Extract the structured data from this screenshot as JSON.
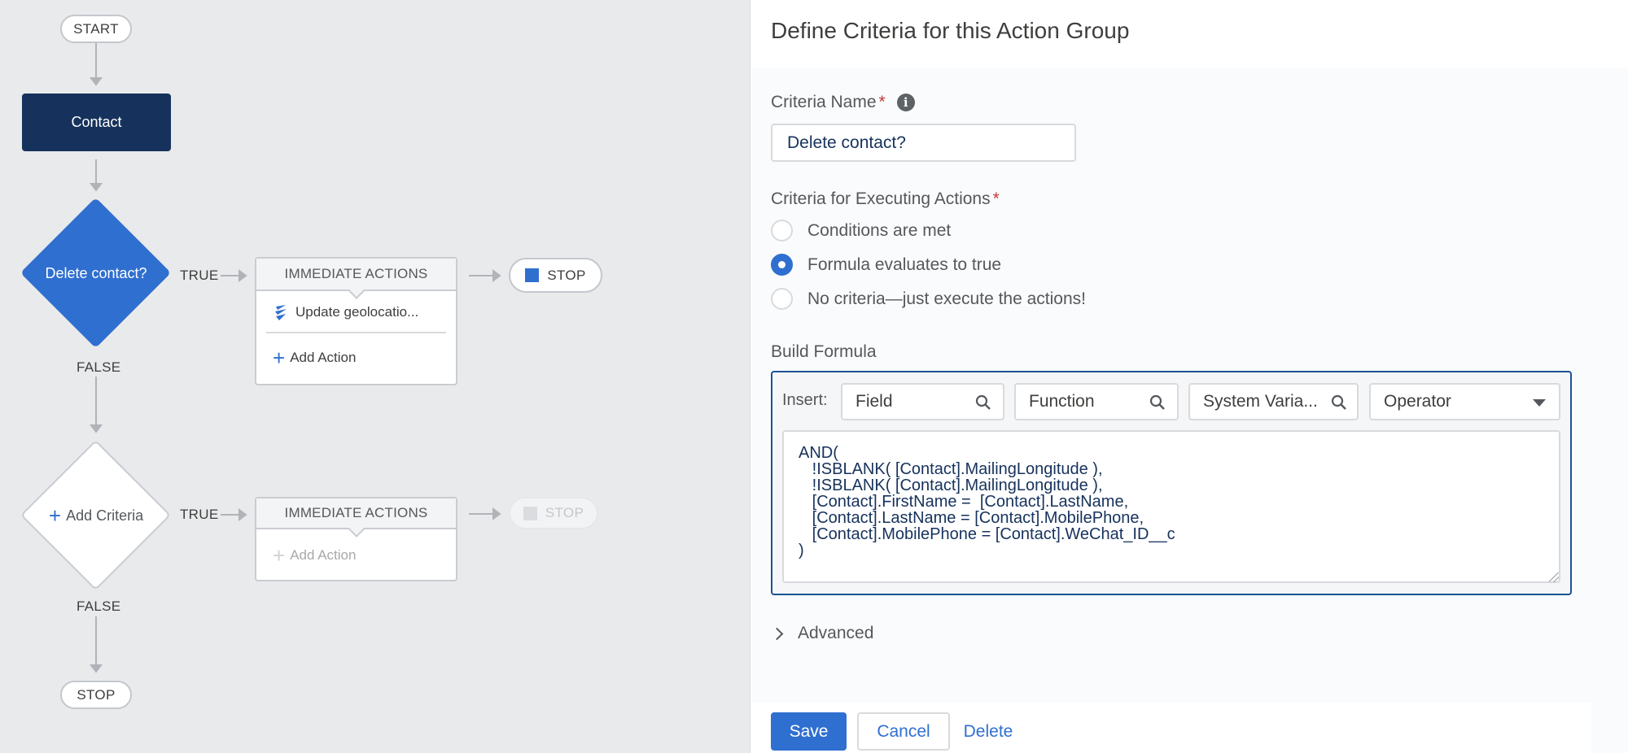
{
  "canvas": {
    "start_label": "START",
    "object_label": "Contact",
    "criteria1": {
      "label": "Delete contact?",
      "true_label": "TRUE",
      "false_label": "FALSE",
      "actions_header": "IMMEDIATE ACTIONS",
      "action_item": "Update geolocatio...",
      "add_action": "Add Action",
      "stop_label": "STOP"
    },
    "criteria2": {
      "label": "Add Criteria",
      "true_label": "TRUE",
      "false_label": "FALSE",
      "actions_header": "IMMEDIATE ACTIONS",
      "add_action": "Add Action",
      "stop_label": "STOP"
    },
    "end_stop_label": "STOP",
    "colors": {
      "object_fill": "#16325c",
      "criteria_fill": "#2f6fd0",
      "accent": "#2f6fd0"
    }
  },
  "panel": {
    "title": "Define Criteria for this Action Group",
    "criteria_name_label": "Criteria Name",
    "criteria_name_value": "Delete contact?",
    "required_mark": "*",
    "executing_label": "Criteria for Executing Actions",
    "radio_options": [
      {
        "label": "Conditions are met",
        "checked": false
      },
      {
        "label": "Formula evaluates to true",
        "checked": true
      },
      {
        "label": "No criteria—just execute the actions!",
        "checked": false
      }
    ],
    "build_formula_label": "Build Formula",
    "insert_label": "Insert:",
    "insert_fields": [
      "Field",
      "Function",
      "System Varia...",
      "Operator"
    ],
    "formula": "AND(\n   !ISBLANK( [Contact].MailingLongitude ),\n   !ISBLANK( [Contact].MailingLongitude ),\n   [Contact].FirstName =  [Contact].LastName,\n   [Contact].LastName = [Contact].MobilePhone,\n   [Contact].MobilePhone = [Contact].WeChat_ID__c\n)",
    "advanced_label": "Advanced",
    "buttons": {
      "save": "Save",
      "cancel": "Cancel",
      "delete": "Delete"
    }
  }
}
